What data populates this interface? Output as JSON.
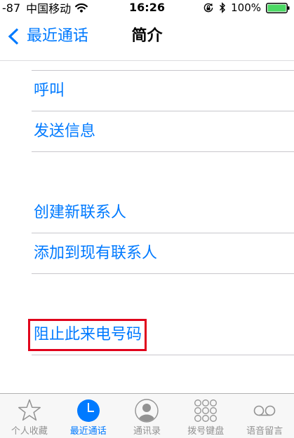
{
  "status_bar": {
    "signal": "-87",
    "carrier": "中国移动",
    "time": "16:26",
    "battery_percent": "100%",
    "battery_level": 1.0,
    "icons": {
      "wifi": "wifi-icon",
      "rotation_lock": "rotation-lock-icon",
      "bluetooth": "bluetooth-icon",
      "battery": "battery-icon"
    }
  },
  "nav_bar": {
    "back_icon": "chevron-left-icon",
    "back_label": "最近通话",
    "title": "简介"
  },
  "sections": [
    {
      "rows": [
        {
          "label": "呼叫",
          "highlighted": false
        },
        {
          "label": "发送信息",
          "highlighted": false
        }
      ]
    },
    {
      "rows": [
        {
          "label": "创建新联系人",
          "highlighted": false
        },
        {
          "label": "添加到现有联系人",
          "highlighted": false
        }
      ]
    },
    {
      "rows": [
        {
          "label": "阻止此来电号码",
          "highlighted": true
        }
      ]
    }
  ],
  "tab_bar": {
    "active_index": 1,
    "tabs": [
      {
        "label": "个人收藏",
        "icon": "star-icon"
      },
      {
        "label": "最近通话",
        "icon": "clock-icon"
      },
      {
        "label": "通讯录",
        "icon": "contacts-icon"
      },
      {
        "label": "拨号键盘",
        "icon": "keypad-icon"
      },
      {
        "label": "语音留言",
        "icon": "voicemail-icon"
      }
    ]
  },
  "colors": {
    "accent": "#007aff",
    "highlight_border": "#e0001b",
    "battery_fill": "#4cd964",
    "inactive_tab": "#929292"
  }
}
